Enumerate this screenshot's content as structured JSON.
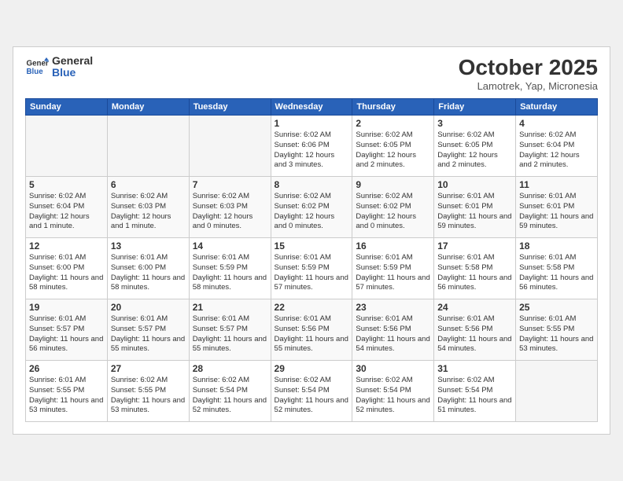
{
  "header": {
    "logo_line1": "General",
    "logo_line2": "Blue",
    "month_title": "October 2025",
    "location": "Lamotrek, Yap, Micronesia"
  },
  "weekdays": [
    "Sunday",
    "Monday",
    "Tuesday",
    "Wednesday",
    "Thursday",
    "Friday",
    "Saturday"
  ],
  "weeks": [
    [
      {
        "day": "",
        "info": ""
      },
      {
        "day": "",
        "info": ""
      },
      {
        "day": "",
        "info": ""
      },
      {
        "day": "1",
        "info": "Sunrise: 6:02 AM\nSunset: 6:06 PM\nDaylight: 12 hours and 3 minutes."
      },
      {
        "day": "2",
        "info": "Sunrise: 6:02 AM\nSunset: 6:05 PM\nDaylight: 12 hours and 2 minutes."
      },
      {
        "day": "3",
        "info": "Sunrise: 6:02 AM\nSunset: 6:05 PM\nDaylight: 12 hours and 2 minutes."
      },
      {
        "day": "4",
        "info": "Sunrise: 6:02 AM\nSunset: 6:04 PM\nDaylight: 12 hours and 2 minutes."
      }
    ],
    [
      {
        "day": "5",
        "info": "Sunrise: 6:02 AM\nSunset: 6:04 PM\nDaylight: 12 hours and 1 minute."
      },
      {
        "day": "6",
        "info": "Sunrise: 6:02 AM\nSunset: 6:03 PM\nDaylight: 12 hours and 1 minute."
      },
      {
        "day": "7",
        "info": "Sunrise: 6:02 AM\nSunset: 6:03 PM\nDaylight: 12 hours and 0 minutes."
      },
      {
        "day": "8",
        "info": "Sunrise: 6:02 AM\nSunset: 6:02 PM\nDaylight: 12 hours and 0 minutes."
      },
      {
        "day": "9",
        "info": "Sunrise: 6:02 AM\nSunset: 6:02 PM\nDaylight: 12 hours and 0 minutes."
      },
      {
        "day": "10",
        "info": "Sunrise: 6:01 AM\nSunset: 6:01 PM\nDaylight: 11 hours and 59 minutes."
      },
      {
        "day": "11",
        "info": "Sunrise: 6:01 AM\nSunset: 6:01 PM\nDaylight: 11 hours and 59 minutes."
      }
    ],
    [
      {
        "day": "12",
        "info": "Sunrise: 6:01 AM\nSunset: 6:00 PM\nDaylight: 11 hours and 58 minutes."
      },
      {
        "day": "13",
        "info": "Sunrise: 6:01 AM\nSunset: 6:00 PM\nDaylight: 11 hours and 58 minutes."
      },
      {
        "day": "14",
        "info": "Sunrise: 6:01 AM\nSunset: 5:59 PM\nDaylight: 11 hours and 58 minutes."
      },
      {
        "day": "15",
        "info": "Sunrise: 6:01 AM\nSunset: 5:59 PM\nDaylight: 11 hours and 57 minutes."
      },
      {
        "day": "16",
        "info": "Sunrise: 6:01 AM\nSunset: 5:59 PM\nDaylight: 11 hours and 57 minutes."
      },
      {
        "day": "17",
        "info": "Sunrise: 6:01 AM\nSunset: 5:58 PM\nDaylight: 11 hours and 56 minutes."
      },
      {
        "day": "18",
        "info": "Sunrise: 6:01 AM\nSunset: 5:58 PM\nDaylight: 11 hours and 56 minutes."
      }
    ],
    [
      {
        "day": "19",
        "info": "Sunrise: 6:01 AM\nSunset: 5:57 PM\nDaylight: 11 hours and 56 minutes."
      },
      {
        "day": "20",
        "info": "Sunrise: 6:01 AM\nSunset: 5:57 PM\nDaylight: 11 hours and 55 minutes."
      },
      {
        "day": "21",
        "info": "Sunrise: 6:01 AM\nSunset: 5:57 PM\nDaylight: 11 hours and 55 minutes."
      },
      {
        "day": "22",
        "info": "Sunrise: 6:01 AM\nSunset: 5:56 PM\nDaylight: 11 hours and 55 minutes."
      },
      {
        "day": "23",
        "info": "Sunrise: 6:01 AM\nSunset: 5:56 PM\nDaylight: 11 hours and 54 minutes."
      },
      {
        "day": "24",
        "info": "Sunrise: 6:01 AM\nSunset: 5:56 PM\nDaylight: 11 hours and 54 minutes."
      },
      {
        "day": "25",
        "info": "Sunrise: 6:01 AM\nSunset: 5:55 PM\nDaylight: 11 hours and 53 minutes."
      }
    ],
    [
      {
        "day": "26",
        "info": "Sunrise: 6:01 AM\nSunset: 5:55 PM\nDaylight: 11 hours and 53 minutes."
      },
      {
        "day": "27",
        "info": "Sunrise: 6:02 AM\nSunset: 5:55 PM\nDaylight: 11 hours and 53 minutes."
      },
      {
        "day": "28",
        "info": "Sunrise: 6:02 AM\nSunset: 5:54 PM\nDaylight: 11 hours and 52 minutes."
      },
      {
        "day": "29",
        "info": "Sunrise: 6:02 AM\nSunset: 5:54 PM\nDaylight: 11 hours and 52 minutes."
      },
      {
        "day": "30",
        "info": "Sunrise: 6:02 AM\nSunset: 5:54 PM\nDaylight: 11 hours and 52 minutes."
      },
      {
        "day": "31",
        "info": "Sunrise: 6:02 AM\nSunset: 5:54 PM\nDaylight: 11 hours and 51 minutes."
      },
      {
        "day": "",
        "info": ""
      }
    ]
  ]
}
